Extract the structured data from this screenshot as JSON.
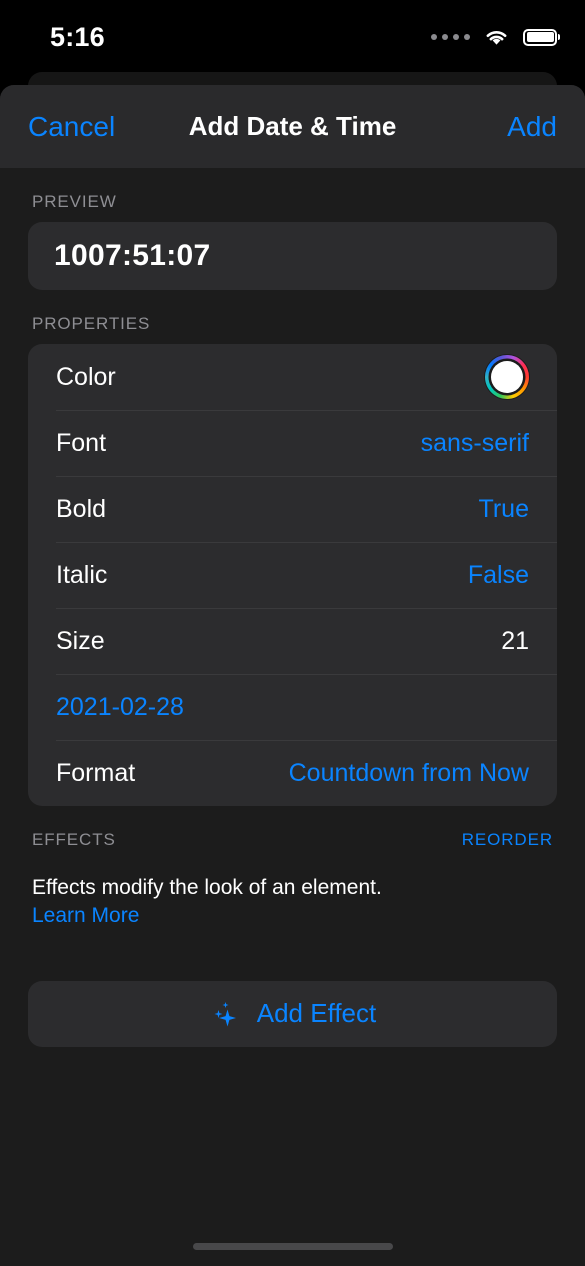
{
  "status_bar": {
    "time": "5:16",
    "cellular_icon": "signal-dots-icon",
    "wifi_icon": "wifi-icon",
    "battery_icon": "battery-full-icon"
  },
  "navbar": {
    "cancel_label": "Cancel",
    "title": "Add Date & Time",
    "add_label": "Add"
  },
  "preview": {
    "section_label": "PREVIEW",
    "value": "1007:51:07"
  },
  "properties": {
    "section_label": "PROPERTIES",
    "rows": [
      {
        "key": "Color",
        "value": "",
        "kind": "colorwheel"
      },
      {
        "key": "Font",
        "value": "sans-serif",
        "kind": "link"
      },
      {
        "key": "Bold",
        "value": "True",
        "kind": "link"
      },
      {
        "key": "Italic",
        "value": "False",
        "kind": "link"
      },
      {
        "key": "Size",
        "value": "21",
        "kind": "plain"
      },
      {
        "key": "2021-02-28",
        "value": "",
        "kind": "keylink"
      },
      {
        "key": "Format",
        "value": "Countdown from Now",
        "kind": "link"
      }
    ]
  },
  "effects": {
    "section_label": "EFFECTS",
    "reorder_label": "REORDER",
    "description": "Effects modify the look of an element.",
    "learn_more_label": "Learn More",
    "add_effect_label": "Add Effect",
    "add_effect_icon": "sparkles-icon"
  },
  "colors": {
    "accent_blue": "#0a84ff",
    "card_background": "#2c2c2e",
    "sheet_background": "#1c1c1c",
    "navbar_background": "#2a2a2c",
    "secondary_label": "#8e8e93"
  }
}
